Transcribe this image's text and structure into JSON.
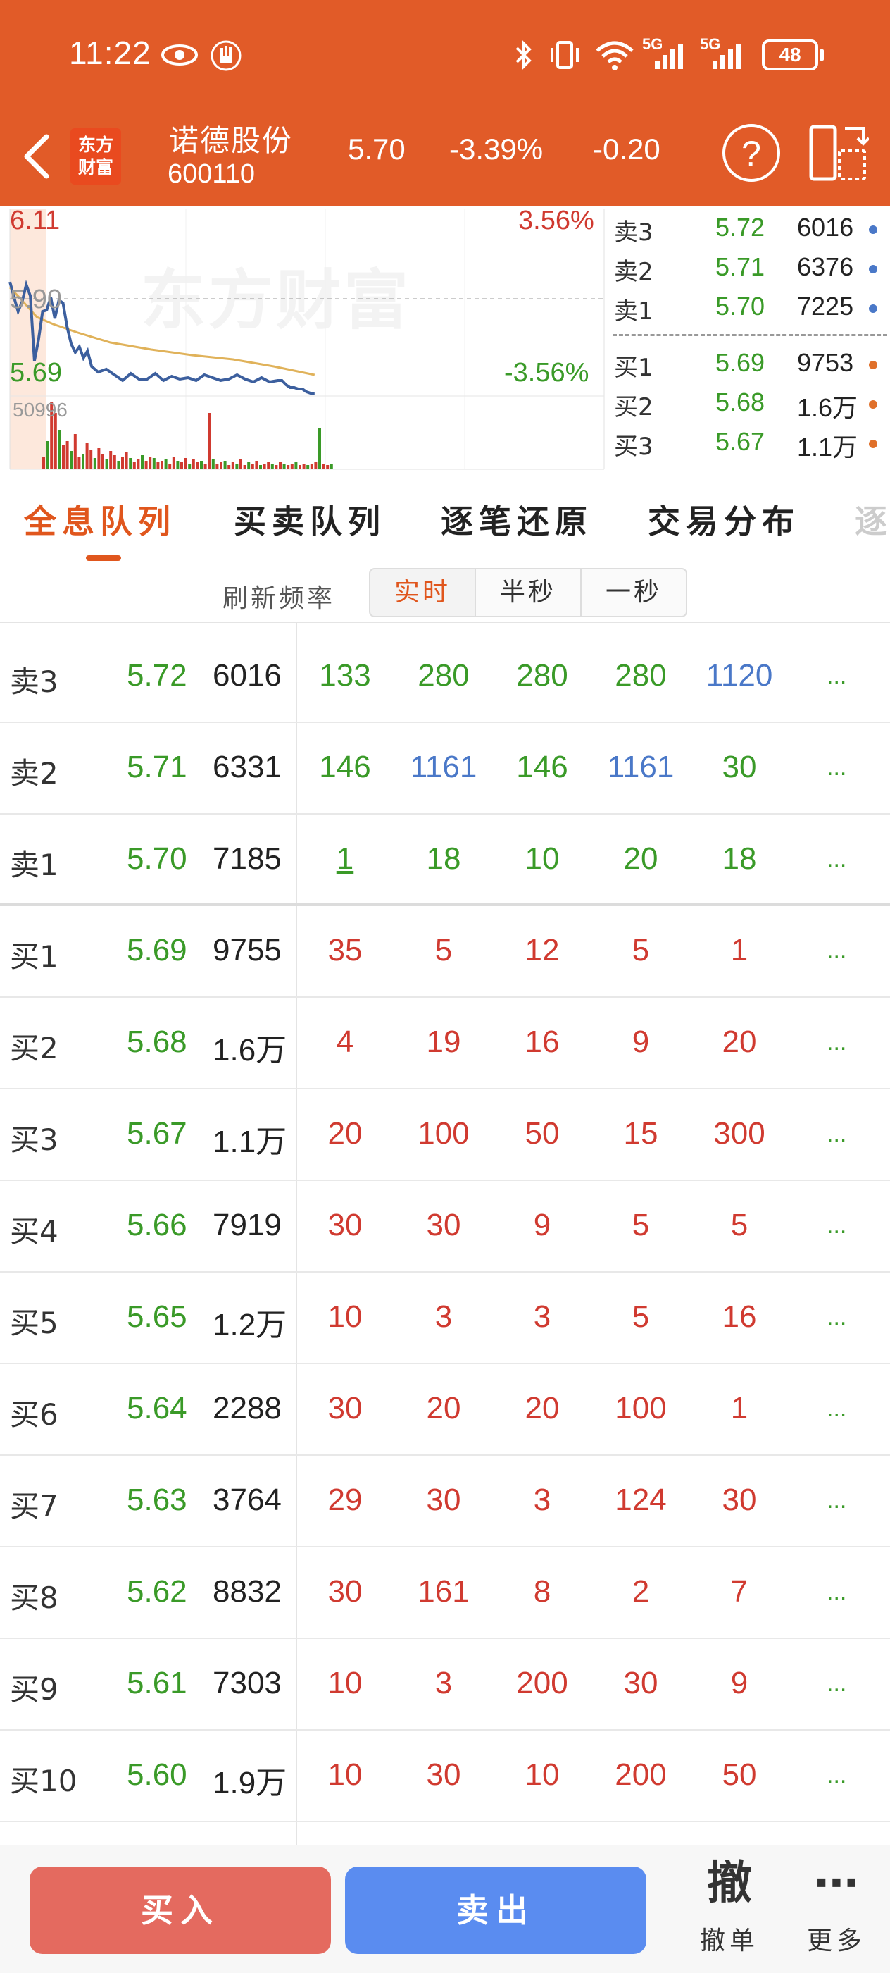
{
  "status_bar": {
    "time": "11:22",
    "battery": "48",
    "net1": "5G",
    "net2": "5G"
  },
  "header": {
    "logo": "东方财富",
    "stock_name": "诺德股份",
    "stock_code": "600110",
    "price": "5.70",
    "change_pct": "-3.39%",
    "change": "-0.20"
  },
  "chart": {
    "watermark": "东方财富",
    "price_high": "6.11",
    "pct_high": "3.56%",
    "price_mid": "5.90",
    "price_low": "5.69",
    "pct_low": "-3.56%",
    "volume_max": "50996",
    "colors": {
      "up": "#d03a30",
      "down": "#3a9a28",
      "price_line": "#3c5f9e",
      "avg_line": "#e0b25a"
    }
  },
  "mini_orderbook": {
    "asks": [
      {
        "label": "卖3",
        "price": "5.72",
        "volume": "6016"
      },
      {
        "label": "卖2",
        "price": "5.71",
        "volume": "6376"
      },
      {
        "label": "卖1",
        "price": "5.70",
        "volume": "7225"
      }
    ],
    "bids": [
      {
        "label": "买1",
        "price": "5.69",
        "volume": "9753"
      },
      {
        "label": "买2",
        "price": "5.68",
        "volume": "1.6万"
      },
      {
        "label": "买3",
        "price": "5.67",
        "volume": "1.1万"
      }
    ]
  },
  "tabs": [
    {
      "label": "全息队列",
      "active": true
    },
    {
      "label": "买卖队列"
    },
    {
      "label": "逐笔还原"
    },
    {
      "label": "交易分布"
    },
    {
      "label": "逐"
    }
  ],
  "refresh": {
    "label": "刷新频率",
    "options": [
      "实时",
      "半秒",
      "一秒"
    ],
    "selected": "实时"
  },
  "queue": [
    {
      "label": "卖3",
      "price": "5.72",
      "volume": "6016",
      "orders": [
        "133",
        "280",
        "280",
        "280",
        "1120"
      ],
      "colors": [
        "g",
        "g",
        "g",
        "g",
        "b"
      ]
    },
    {
      "label": "卖2",
      "price": "5.71",
      "volume": "6331",
      "orders": [
        "146",
        "1161",
        "146",
        "1161",
        "30"
      ],
      "colors": [
        "g",
        "b",
        "g",
        "b",
        "g"
      ]
    },
    {
      "label": "卖1",
      "price": "5.70",
      "volume": "7185",
      "orders": [
        "1",
        "18",
        "10",
        "20",
        "18"
      ],
      "colors": [
        "g",
        "g",
        "g",
        "g",
        "g"
      ]
    },
    {
      "label": "买1",
      "price": "5.69",
      "volume": "9755",
      "orders": [
        "35",
        "5",
        "12",
        "5",
        "1"
      ],
      "colors": [
        "r",
        "r",
        "r",
        "r",
        "r"
      ]
    },
    {
      "label": "买2",
      "price": "5.68",
      "volume": "1.6万",
      "orders": [
        "4",
        "19",
        "16",
        "9",
        "20"
      ],
      "colors": [
        "r",
        "r",
        "r",
        "r",
        "r"
      ]
    },
    {
      "label": "买3",
      "price": "5.67",
      "volume": "1.1万",
      "orders": [
        "20",
        "100",
        "50",
        "15",
        "300"
      ],
      "colors": [
        "r",
        "r",
        "r",
        "r",
        "r"
      ]
    },
    {
      "label": "买4",
      "price": "5.66",
      "volume": "7919",
      "orders": [
        "30",
        "30",
        "9",
        "5",
        "5"
      ],
      "colors": [
        "r",
        "r",
        "r",
        "r",
        "r"
      ]
    },
    {
      "label": "买5",
      "price": "5.65",
      "volume": "1.2万",
      "orders": [
        "10",
        "3",
        "3",
        "5",
        "16"
      ],
      "colors": [
        "r",
        "r",
        "r",
        "r",
        "r"
      ]
    },
    {
      "label": "买6",
      "price": "5.64",
      "volume": "2288",
      "orders": [
        "30",
        "20",
        "20",
        "100",
        "1"
      ],
      "colors": [
        "r",
        "r",
        "r",
        "r",
        "r"
      ]
    },
    {
      "label": "买7",
      "price": "5.63",
      "volume": "3764",
      "orders": [
        "29",
        "30",
        "3",
        "124",
        "30"
      ],
      "colors": [
        "r",
        "r",
        "r",
        "r",
        "r"
      ]
    },
    {
      "label": "买8",
      "price": "5.62",
      "volume": "8832",
      "orders": [
        "30",
        "161",
        "8",
        "2",
        "7"
      ],
      "colors": [
        "r",
        "r",
        "r",
        "r",
        "r"
      ]
    },
    {
      "label": "买9",
      "price": "5.61",
      "volume": "7303",
      "orders": [
        "10",
        "3",
        "200",
        "30",
        "9"
      ],
      "colors": [
        "r",
        "r",
        "r",
        "r",
        "r"
      ]
    },
    {
      "label": "买10",
      "price": "5.60",
      "volume": "1.9万",
      "orders": [
        "10",
        "30",
        "10",
        "200",
        "50"
      ],
      "colors": [
        "r",
        "r",
        "r",
        "r",
        "r"
      ]
    }
  ],
  "queue_more": "...",
  "bottom": {
    "buy": "买入",
    "sell": "卖出",
    "cancel_icon": "撤",
    "cancel_label": "撤单",
    "more_icon": "⋯",
    "more_label": "更多"
  }
}
